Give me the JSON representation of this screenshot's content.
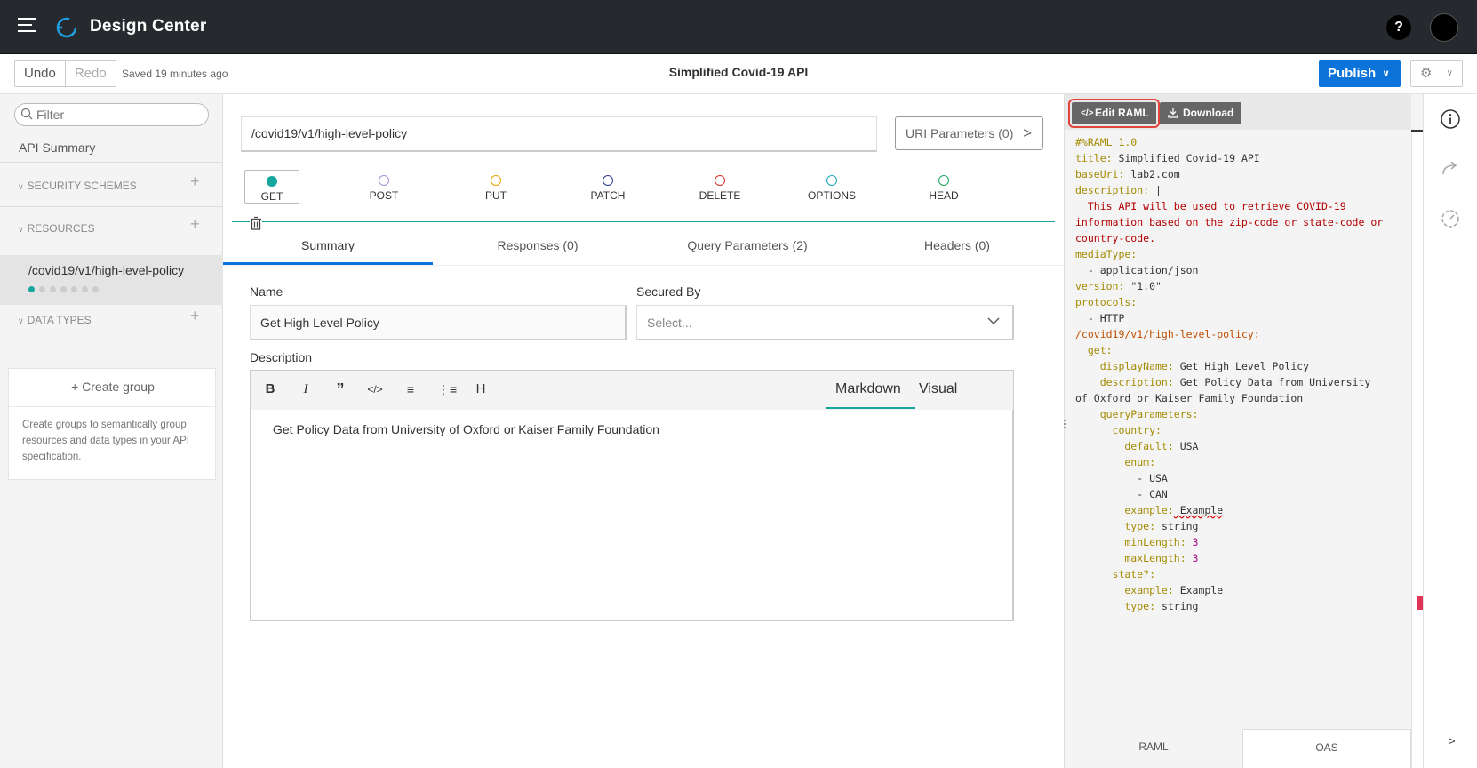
{
  "app": {
    "title": "Design Center"
  },
  "header": {
    "help_label": "?"
  },
  "toolbar": {
    "undo_label": "Undo",
    "redo_label": "Redo",
    "saved_text": "Saved 19 minutes ago",
    "api_title": "Simplified Covid-19 API",
    "publish_label": "Publish"
  },
  "sidebar": {
    "filter_placeholder": "Filter",
    "api_summary": "API Summary",
    "security_schemes": "SECURITY SCHEMES",
    "resources": "RESOURCES",
    "resource_item": "/covid19/v1/high-level-policy",
    "data_types": "DATA TYPES",
    "create_group": "+ Create group",
    "create_group_desc": "Create groups to semantically group resources and data types in your API specification."
  },
  "main": {
    "path": "/covid19/v1/high-level-policy",
    "uri_params": "URI Parameters (0)",
    "methods": [
      {
        "label": "GET",
        "color": "#17a69b",
        "selected": true
      },
      {
        "label": "POST",
        "color": "#a78fd0"
      },
      {
        "label": "PUT",
        "color": "#e8a500"
      },
      {
        "label": "PATCH",
        "color": "#2b3a8f"
      },
      {
        "label": "DELETE",
        "color": "#d9312b"
      },
      {
        "label": "OPTIONS",
        "color": "#1aa8b0"
      },
      {
        "label": "HEAD",
        "color": "#17a657"
      }
    ],
    "tabs": [
      "Summary",
      "Responses (0)",
      "Query Parameters (2)",
      "Headers (0)"
    ],
    "name_label": "Name",
    "name_value": "Get High Level Policy",
    "secured_label": "Secured By",
    "secured_placeholder": "Select...",
    "description_label": "Description",
    "editor_markdown": "Markdown",
    "editor_visual": "Visual",
    "description_text": "Get Policy Data from University of Oxford or Kaiser Family Foundation"
  },
  "raml": {
    "edit_label": "Edit RAML",
    "download_label": "Download",
    "tab_raml": "RAML",
    "tab_oas": "OAS",
    "code": {
      "l1": "#%RAML 1.0",
      "title_k": "title:",
      "title_v": " Simplified Covid-19 API",
      "baseuri_k": "baseUri:",
      "baseuri_v": " lab2.com",
      "desc_k": "description:",
      "desc_v": " |",
      "desc1": "  This API will be used to retrieve COVID-19",
      "desc2": "information based on the zip-code or state-code or",
      "desc3": "country-code.",
      "media_k": "mediaType:",
      "media_v": "  - application/json",
      "version_k": "version:",
      "version_v": " \"1.0\"",
      "protocols_k": "protocols:",
      "protocols_v": "  - HTTP",
      "path": "/covid19/v1/high-level-policy:",
      "get": "  get:",
      "dn_k": "    displayName:",
      "dn_v": " Get High Level Policy",
      "d_k": "    description:",
      "d_v": " Get Policy Data from University",
      "d_v2": "of Oxford or Kaiser Family Foundation",
      "qp": "    queryParameters:",
      "country": "      country:",
      "default_k": "        default:",
      "default_v": " USA",
      "enum": "        enum:",
      "usa": "          - USA",
      "can": "          - CAN",
      "ex_k": "        example:",
      "ex_v": " Example",
      "type_k": "        type:",
      "type_v": " string",
      "min_k": "        minLength:",
      "min_v": " 3",
      "max_k": "        maxLength:",
      "max_v": " 3",
      "state": "      state?:",
      "ex2_k": "        example:",
      "ex2_v": " Example",
      "type2_k": "        type:",
      "type2_v": " string"
    }
  },
  "rail": {
    "collapse_label": ">"
  }
}
